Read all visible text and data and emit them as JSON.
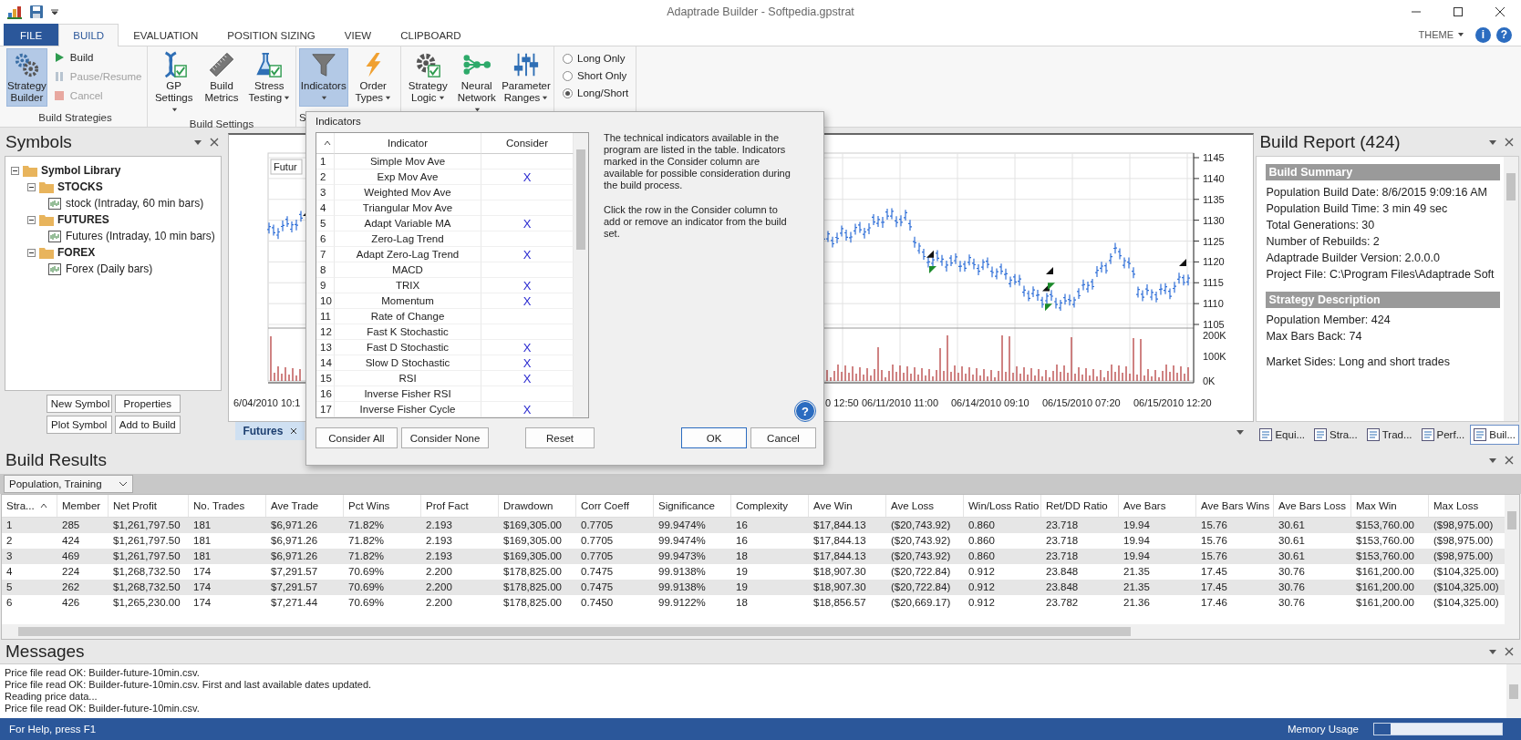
{
  "window": {
    "title": "Adaptrade Builder - Softpedia.gpstrat"
  },
  "tabs": [
    {
      "label": "FILE",
      "kind": "file",
      "selected": false
    },
    {
      "label": "BUILD",
      "kind": "tab",
      "selected": true
    },
    {
      "label": "EVALUATION",
      "kind": "tab",
      "selected": false
    },
    {
      "label": "POSITION SIZING",
      "kind": "tab",
      "selected": false
    },
    {
      "label": "VIEW",
      "kind": "tab",
      "selected": false
    },
    {
      "label": "CLIPBOARD",
      "kind": "tab",
      "selected": false
    }
  ],
  "ribbon_right": {
    "theme": "THEME",
    "info_glyph": "i",
    "help_glyph": "?"
  },
  "ribbon_groups": [
    {
      "label": "Build Strategies",
      "buttons": [
        {
          "kind": "large",
          "label": "Strategy Builder",
          "selected": true,
          "dropdown": false
        },
        {
          "kind": "small",
          "label": "Build",
          "disabled": false
        },
        {
          "kind": "small",
          "label": "Pause/Resume",
          "disabled": true
        },
        {
          "kind": "small",
          "label": "Cancel",
          "disabled": true
        }
      ]
    },
    {
      "label": "Build Settings",
      "buttons": [
        {
          "kind": "large",
          "label": "GP Settings",
          "selected": false,
          "dropdown": true
        },
        {
          "kind": "large",
          "label": "Build Metrics",
          "selected": false,
          "dropdown": false
        },
        {
          "kind": "large",
          "label": "Stress Testing",
          "selected": false,
          "dropdown": true
        }
      ]
    },
    {
      "label": "S",
      "buttons": [
        {
          "kind": "large",
          "label": "Indicators",
          "selected": true,
          "dropdown": true
        },
        {
          "kind": "large",
          "label": "Order Types",
          "selected": false,
          "dropdown": true
        }
      ]
    },
    {
      "buttons": [
        {
          "kind": "large",
          "label": "Strategy Logic",
          "selected": false,
          "dropdown": true
        },
        {
          "kind": "large",
          "label": "Neural Network",
          "selected": false,
          "dropdown": true
        },
        {
          "kind": "large",
          "label": "Parameter Ranges",
          "selected": false,
          "dropdown": true
        }
      ]
    },
    {
      "buttons": [
        {
          "kind": "radio",
          "label": "Long Only",
          "selected": false
        },
        {
          "kind": "radio",
          "label": "Short Only",
          "selected": false
        },
        {
          "kind": "radio",
          "label": "Long/Short",
          "selected": true
        }
      ]
    }
  ],
  "symbols": {
    "title": "Symbols",
    "tree": [
      {
        "label": "Symbol Library",
        "expanded": true,
        "children": [
          {
            "label": "STOCKS",
            "expanded": true,
            "children": [
              {
                "label": "stock (Intraday, 60 min bars)"
              }
            ]
          },
          {
            "label": "FUTURES",
            "expanded": true,
            "children": [
              {
                "label": "Futures (Intraday, 10 min bars)"
              }
            ]
          },
          {
            "label": "FOREX",
            "expanded": true,
            "children": [
              {
                "label": "Forex (Daily bars)"
              }
            ]
          }
        ]
      }
    ],
    "buttons": [
      "New Symbol",
      "Properties",
      "Plot Symbol",
      "Add to Build"
    ]
  },
  "chart": {
    "series_label": "Futur",
    "price_ticks": [
      "1145",
      "1140",
      "1135",
      "1130",
      "1125",
      "1120",
      "1115",
      "1110",
      "1105"
    ],
    "volume_ticks": [
      "200K",
      "100K",
      "0K"
    ],
    "date_labels": [
      "6/04/2010 10:1",
      "0 12:50",
      "06/11/2010 11:00",
      "06/14/2010 09:10",
      "06/15/2010 07:20",
      "06/15/2010 12:20"
    ],
    "tab": "Futures"
  },
  "dialog": {
    "title": "Indicators",
    "columns": [
      "Indicator",
      "Consider"
    ],
    "rows": [
      {
        "number": "1",
        "name": "Simple Mov Ave"
      },
      {
        "number": "2",
        "name": "Exp Mov Ave",
        "consider": "X"
      },
      {
        "number": "3",
        "name": "Weighted Mov Ave"
      },
      {
        "number": "4",
        "name": "Triangular Mov Ave"
      },
      {
        "number": "5",
        "name": "Adapt Variable MA",
        "consider": "X"
      },
      {
        "number": "6",
        "name": "Zero-Lag Trend"
      },
      {
        "number": "7",
        "name": "Adapt Zero-Lag Trend",
        "consider": "X"
      },
      {
        "number": "8",
        "name": "MACD"
      },
      {
        "number": "9",
        "name": "TRIX",
        "consider": "X"
      },
      {
        "number": "10",
        "name": "Momentum",
        "consider": "X"
      },
      {
        "number": "11",
        "name": "Rate of Change"
      },
      {
        "number": "12",
        "name": "Fast K Stochastic"
      },
      {
        "number": "13",
        "name": "Fast D Stochastic",
        "consider": "X"
      },
      {
        "number": "14",
        "name": "Slow D Stochastic",
        "consider": "X"
      },
      {
        "number": "15",
        "name": "RSI",
        "consider": "X"
      },
      {
        "number": "16",
        "name": "Inverse Fisher RSI"
      },
      {
        "number": "17",
        "name": "Inverse Fisher Cycle",
        "consider": "X"
      }
    ],
    "paragraphs": [
      "The technical indicators available in the program are listed in the table. Indicators marked in the Consider column are available for possible consideration during the build process.",
      "Click the row in the Consider column to add or remove an indicator from the build set."
    ],
    "help_glyph": "?",
    "left_buttons": [
      "Consider All",
      "Consider None"
    ],
    "reset": "Reset",
    "ok": "OK",
    "cancel": "Cancel"
  },
  "build_report": {
    "title": "Build Report (424)",
    "sections": [
      {
        "heading": "Build Summary",
        "paragraphs": [
          [
            "Population Build Date: 8/6/2015 9:09:16 AM",
            "Population Build Time: 3 min 49 sec",
            "Total Generations: 30",
            "Number of Rebuilds: 2",
            "Adaptrade Builder Version: 2.0.0.0",
            "Project File: C:\\Program Files\\Adaptrade Soft"
          ]
        ]
      },
      {
        "heading": "Strategy Description",
        "paragraphs": [
          [
            "Population Member: 424",
            "Max Bars Back: 74"
          ],
          [
            "Market Sides: Long and short trades"
          ]
        ]
      }
    ],
    "tabs": [
      {
        "label": "Equi...",
        "selected": false
      },
      {
        "label": "Stra...",
        "selected": false
      },
      {
        "label": "Trad...",
        "selected": false
      },
      {
        "label": "Perf...",
        "selected": false
      },
      {
        "label": "Buil...",
        "selected": true
      }
    ]
  },
  "build_results": {
    "title": "Build Results",
    "filter": "Population, Training",
    "columns": [
      "Stra...",
      "Member",
      "Net Profit",
      "No. Trades",
      "Ave Trade",
      "Pct Wins",
      "Prof Fact",
      "Drawdown",
      "Corr Coeff",
      "Significance",
      "Complexity",
      "Ave Win",
      "Ave Loss",
      "Win/Loss Ratio",
      "Ret/DD Ratio",
      "Ave Bars",
      "Ave Bars Wins",
      "Ave Bars Loss",
      "Max Win",
      "Max Loss"
    ],
    "rows": [
      [
        "1",
        "285",
        "$1,261,797.50",
        "181",
        "$6,971.26",
        "71.82%",
        "2.193",
        "$169,305.00",
        "0.7705",
        "99.9474%",
        "16",
        "$17,844.13",
        "($20,743.92)",
        "0.860",
        "23.718",
        "19.94",
        "15.76",
        "30.61",
        "$153,760.00",
        "($98,975.00)"
      ],
      [
        "2",
        "424",
        "$1,261,797.50",
        "181",
        "$6,971.26",
        "71.82%",
        "2.193",
        "$169,305.00",
        "0.7705",
        "99.9474%",
        "16",
        "$17,844.13",
        "($20,743.92)",
        "0.860",
        "23.718",
        "19.94",
        "15.76",
        "30.61",
        "$153,760.00",
        "($98,975.00)"
      ],
      [
        "3",
        "469",
        "$1,261,797.50",
        "181",
        "$6,971.26",
        "71.82%",
        "2.193",
        "$169,305.00",
        "0.7705",
        "99.9473%",
        "18",
        "$17,844.13",
        "($20,743.92)",
        "0.860",
        "23.718",
        "19.94",
        "15.76",
        "30.61",
        "$153,760.00",
        "($98,975.00)"
      ],
      [
        "4",
        "224",
        "$1,268,732.50",
        "174",
        "$7,291.57",
        "70.69%",
        "2.200",
        "$178,825.00",
        "0.7475",
        "99.9138%",
        "19",
        "$18,907.30",
        "($20,722.84)",
        "0.912",
        "23.848",
        "21.35",
        "17.45",
        "30.76",
        "$161,200.00",
        "($104,325.00)"
      ],
      [
        "5",
        "262",
        "$1,268,732.50",
        "174",
        "$7,291.57",
        "70.69%",
        "2.200",
        "$178,825.00",
        "0.7475",
        "99.9138%",
        "19",
        "$18,907.30",
        "($20,722.84)",
        "0.912",
        "23.848",
        "21.35",
        "17.45",
        "30.76",
        "$161,200.00",
        "($104,325.00)"
      ],
      [
        "6",
        "426",
        "$1,265,230.00",
        "174",
        "$7,271.44",
        "70.69%",
        "2.200",
        "$178,825.00",
        "0.7450",
        "99.9122%",
        "18",
        "$18,856.57",
        "($20,669.17)",
        "0.912",
        "23.782",
        "21.36",
        "17.46",
        "30.76",
        "$161,200.00",
        "($104,325.00)"
      ]
    ]
  },
  "messages": {
    "title": "Messages",
    "lines": [
      "Price file read OK: Builder-future-10min.csv.",
      "Price file read OK: Builder-future-10min.csv. First and last available dates updated.",
      "Reading price data...",
      "Price file read OK: Builder-future-10min.csv."
    ]
  },
  "status_bar": {
    "help": "For Help, press F1",
    "memory_label": "Memory Usage",
    "memory": {
      "level": 0.13
    }
  }
}
